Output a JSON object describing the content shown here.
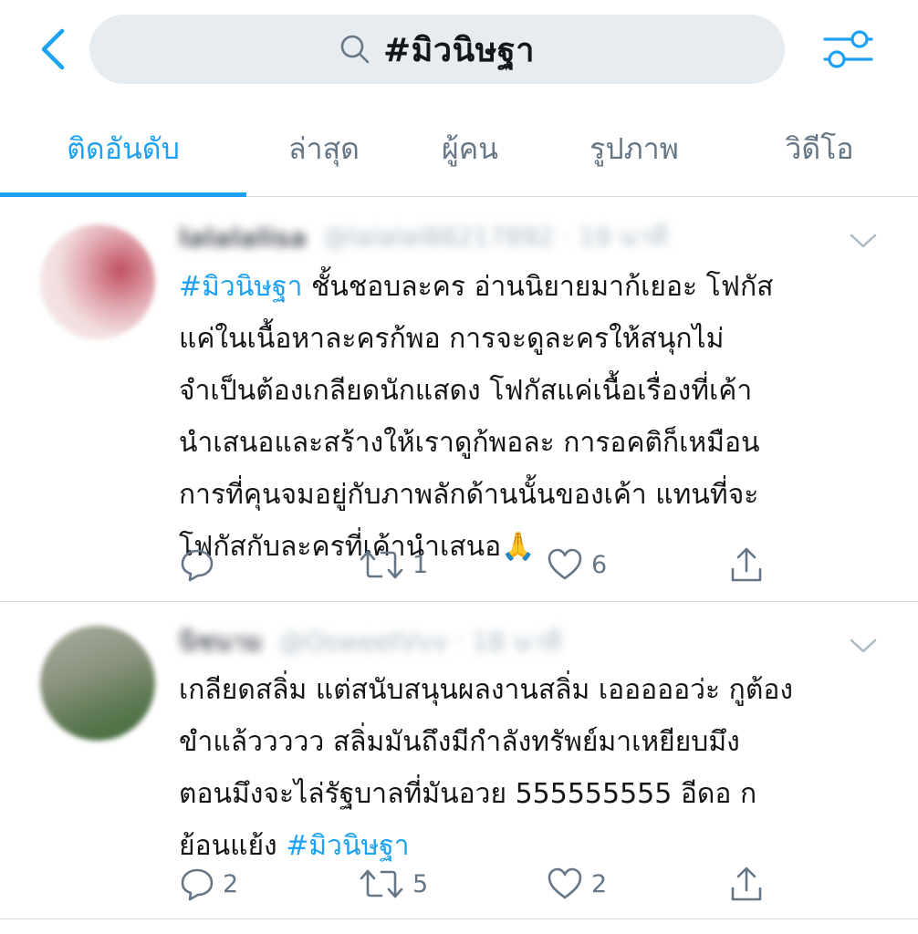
{
  "search": {
    "query": "#มิวนิษฐา"
  },
  "icons": {
    "back": "chevron-left-icon",
    "search": "magnifier-icon",
    "filter": "filter-sliders-icon",
    "caret": "chevron-down-icon",
    "reply": "reply-icon",
    "retweet": "retweet-icon",
    "like": "heart-icon",
    "share": "share-icon"
  },
  "colors": {
    "accent": "#1da1f2",
    "muted": "#657786",
    "text": "#14171a",
    "pill": "#e6ecf0"
  },
  "tabs": [
    {
      "label": "ติดอันดับ",
      "active": true
    },
    {
      "label": "ล่าสุด"
    },
    {
      "label": "ผู้คน"
    },
    {
      "label": "รูปภาพ"
    },
    {
      "label": "วิดีโอ"
    }
  ],
  "tweets": [
    {
      "display_name": "lalalalisa",
      "handle": "@lalalal88217892 · 19 นาที",
      "hashtag": "#มิวนิษฐา",
      "text": "  ชั้นชอบละคร อ่านนิยายมาก้เยอะ โฟกัส\nแค่ในเนื้อหาละครก้พอ การจะดูละครให้สนุกไม่\nจำเป็นต้องเกลียดนักแสดง โฟกัสแค่เนื้อเรื่องที่เค้า\nนำเสนอและสร้างให้เราดูก้พอละ การอคติก็เหมือน\nการที่คุนจมอยู่กับภาพลักด้านนั้นของเค้า แทนที่จะ\nโฟกัสกับละครที่เค้านำเสนอ🙏",
      "reply_count": "",
      "retweet_count": "1",
      "like_count": "6"
    },
    {
      "display_name": "นิชนาม",
      "handle": "@OsweetVvv · 18 นาที",
      "text": "เกลียดสลิ่ม แต่สนับสนุนผลงานสลิ่ม เอออออว่ะ  กูต้อง\nขำแล้ววววว สลิ่มมันถึงมีกำลังทรัพย์มาเหยียบมึง\nตอนมึงจะไล่รัฐบาลที่มันอวย 555555555   อีดอ ก\nย้อนแย้ง ",
      "hashtag": "#มิวนิษฐา",
      "reply_count": "2",
      "retweet_count": "5",
      "like_count": "2"
    }
  ]
}
